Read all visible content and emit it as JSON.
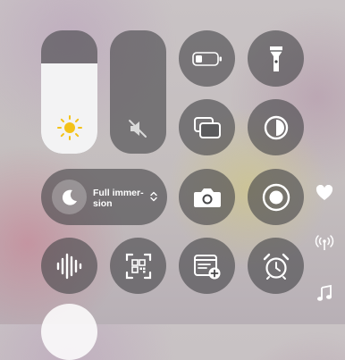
{
  "control_center": {
    "brightness": {
      "level": 0.73
    },
    "volume": {
      "level": 0.0,
      "muted": true
    },
    "focus": {
      "label_line1": "Full immer-",
      "label_line2": "sion"
    },
    "icons": [
      "sun-icon",
      "speaker-mute-icon",
      "battery-icon",
      "flashlight-icon",
      "screen-mirroring-icon",
      "dark-mode-icon",
      "moon-icon",
      "chevron-updown-icon",
      "camera-icon",
      "screen-record-icon",
      "heart-icon",
      "voice-memo-icon",
      "qr-scanner-icon",
      "quick-note-icon",
      "alarm-icon",
      "antenna-icon",
      "music-note-icon"
    ],
    "colors": {
      "tile": "#464648",
      "active": "#f3f3f4",
      "sun": "#f3c21a"
    }
  }
}
